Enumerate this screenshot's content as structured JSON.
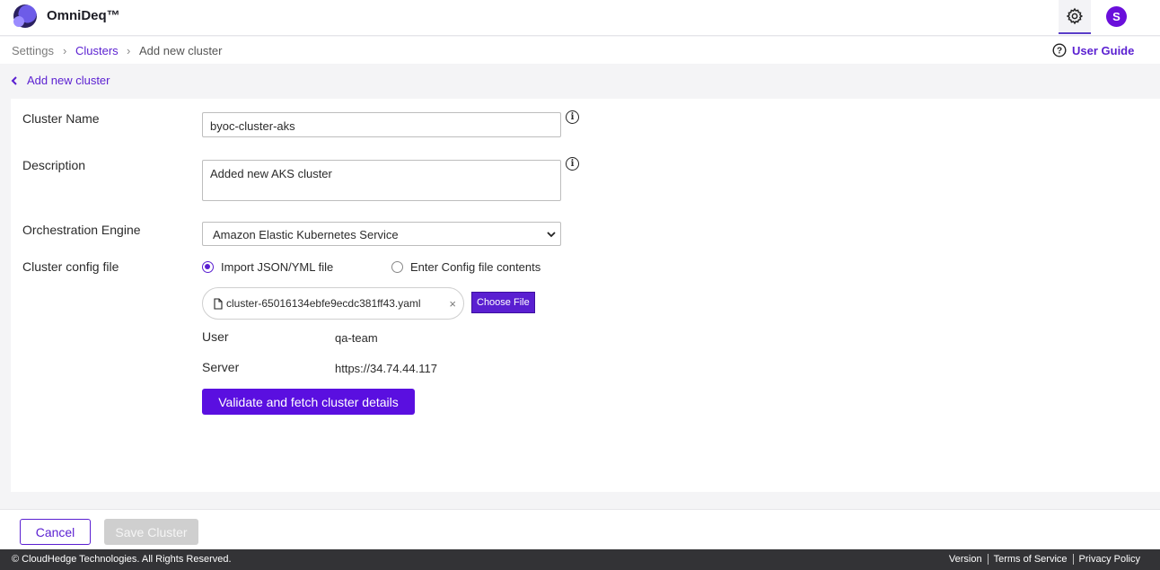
{
  "header": {
    "app_name": "OmniDeq™",
    "avatar_initial": "S"
  },
  "breadcrumb": {
    "settings": "Settings",
    "clusters": "Clusters",
    "current": "Add new cluster",
    "separator": "›"
  },
  "user_guide": {
    "label": "User Guide"
  },
  "back_link": {
    "label": "Add new cluster"
  },
  "form": {
    "cluster_name": {
      "label": "Cluster Name",
      "value": "byoc-cluster-aks"
    },
    "description": {
      "label": "Description",
      "value": "Added new AKS cluster"
    },
    "orchestration_engine": {
      "label": "Orchestration Engine",
      "selected": "Amazon Elastic Kubernetes Service"
    },
    "config_file": {
      "label": "Cluster config file",
      "option_import": "Import JSON/YML file",
      "option_enter": "Enter Config file contents",
      "file_name": "cluster-65016134ebfe9ecdc381ff43.yaml",
      "choose_button": "Choose File"
    },
    "details": {
      "user_label": "User",
      "user_value": "qa-team",
      "server_label": "Server",
      "server_value": "https://34.74.44.117"
    },
    "validate_button": "Validate and fetch cluster details"
  },
  "actions": {
    "cancel": "Cancel",
    "save": "Save Cluster"
  },
  "footer": {
    "copyright": "© CloudHedge Technologies. All Rights Reserved.",
    "links": [
      "Version",
      "Terms of Service",
      "Privacy Policy"
    ]
  },
  "colors": {
    "accent": "#5a1fd1",
    "primary_button": "#5a0fe0",
    "footer_bg": "#333336"
  }
}
